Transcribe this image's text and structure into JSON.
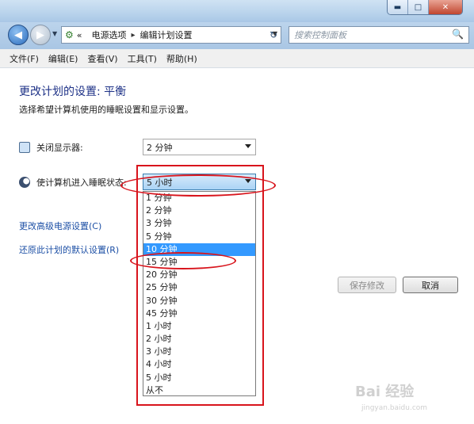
{
  "window": {
    "caption_buttons": {
      "minimize": "▬",
      "maximize": "□",
      "close": "✕"
    }
  },
  "navbar": {
    "back_icon": "◀",
    "forward_icon": "▶",
    "history_drop": "▼",
    "breadcrumb": {
      "prefix": "«",
      "items": [
        "电源选项",
        "编辑计划设置"
      ],
      "separator": "▸"
    },
    "refresh_icon": "↻",
    "search_placeholder": "搜索控制面板",
    "search_icon": "🔍"
  },
  "menu": [
    "文件(F)",
    "编辑(E)",
    "查看(V)",
    "工具(T)",
    "帮助(H)"
  ],
  "page": {
    "title": "更改计划的设置: 平衡",
    "subtitle": "选择希望计算机使用的睡眠设置和显示设置。",
    "display_label": "关闭显示器:",
    "display_value": "2 分钟",
    "sleep_label": "使计算机进入睡眠状态:",
    "sleep_value": "5 小时",
    "advanced_link": "更改高级电源设置(C)",
    "restore_link": "还原此计划的默认设置(R)",
    "save_button": "保存修改",
    "cancel_button": "取消"
  },
  "dropdown": {
    "selected_index": 4,
    "options": [
      "1 分钟",
      "2 分钟",
      "3 分钟",
      "5 分钟",
      "10 分钟",
      "15 分钟",
      "20 分钟",
      "25 分钟",
      "30 分钟",
      "45 分钟",
      "1 小时",
      "2 小时",
      "3 小时",
      "4 小时",
      "5 小时",
      "从不"
    ]
  },
  "watermark": {
    "text": "Bai 经验",
    "sub": "jingyan.baidu.com"
  },
  "colors": {
    "accent_title": "#1e3287",
    "link": "#1c4fa5",
    "selection": "#3399ff",
    "annotation": "#d8141c"
  }
}
